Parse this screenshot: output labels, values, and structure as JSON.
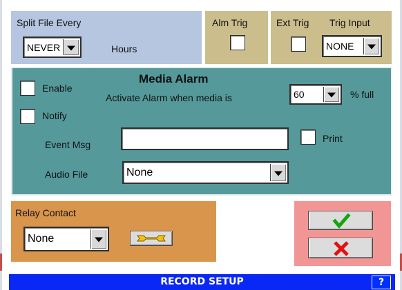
{
  "split": {
    "label": "Split File Every",
    "value": "NEVER",
    "units": "Hours"
  },
  "alm_trig": {
    "label": "Alm Trig",
    "checked": false
  },
  "ext_trig": {
    "label": "Ext Trig",
    "checked": false
  },
  "trig_input": {
    "label": "Trig Input",
    "value": "NONE"
  },
  "media_alarm": {
    "title": "Media Alarm",
    "enable_label": "Enable",
    "enable_checked": false,
    "activate_label": "Activate Alarm when media is",
    "percent_value": "60",
    "percent_suffix": "% full",
    "notify_label": "Notify",
    "notify_checked": false,
    "event_msg_label": "Event Msg",
    "event_msg_value": "",
    "print_label": "Print",
    "print_checked": false,
    "audio_file_label": "Audio File",
    "audio_file_value": "None"
  },
  "relay": {
    "label": "Relay Contact",
    "value": "None",
    "edit_icon": "wrench-icon"
  },
  "actions": {
    "ok_icon": "checkmark-icon",
    "cancel_icon": "x-icon",
    "ok_color": "#17a40e",
    "cancel_color": "#e21212"
  },
  "footer": {
    "title": "RECORD SETUP",
    "help": "?"
  }
}
